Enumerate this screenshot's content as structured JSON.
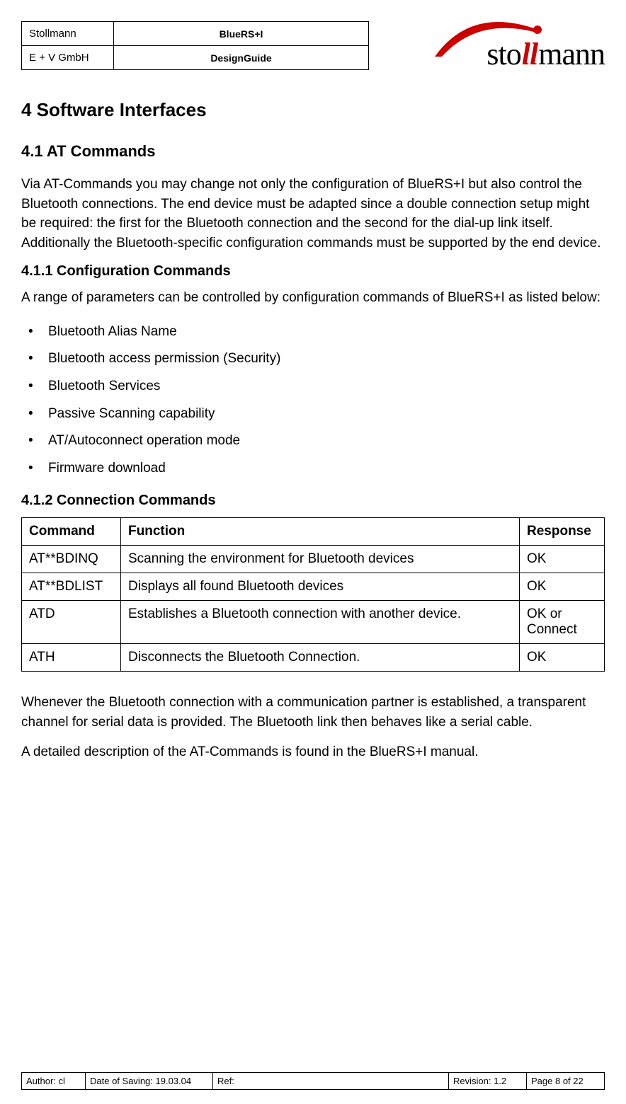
{
  "header": {
    "company_top": "Stollmann",
    "company_bottom": "E + V GmbH",
    "doc_top": "BlueRS+I",
    "doc_bottom": "DesignGuide",
    "logo_text_pre": "sto",
    "logo_text_mid": "ll",
    "logo_text_post": "mann"
  },
  "h1": "4   Software Interfaces",
  "h2": "4.1   AT Commands",
  "p1": "Via AT-Commands you may change not only the configuration of BlueRS+I but also control the Bluetooth connections. The end device must be adapted since a double connection setup might be required: the first for the Bluetooth connection and the second for the dial-up link itself. Additionally the Bluetooth-specific configuration commands must be supported by the end device.",
  "h3a": "4.1.1   Configuration Commands",
  "p2": "A range of parameters can be controlled by configuration commands of BlueRS+I as listed below:",
  "bullets": [
    "Bluetooth Alias Name",
    "Bluetooth access permission (Security)",
    "Bluetooth Services",
    "Passive Scanning capability",
    "AT/Autoconnect operation mode",
    "Firmware download"
  ],
  "h3b": "4.1.2   Connection Commands",
  "table": {
    "headers": [
      "Command",
      "Function",
      "Response"
    ],
    "rows": [
      {
        "cmd": "AT**BDINQ",
        "func": "Scanning the environment for Bluetooth devices",
        "resp": "OK"
      },
      {
        "cmd": "AT**BDLIST",
        "func": "Displays all found Bluetooth devices",
        "resp": "OK"
      },
      {
        "cmd": "ATD",
        "func": "Establishes a Bluetooth connection with another  device.",
        "resp": "OK or Connect"
      },
      {
        "cmd": "ATH",
        "func": "Disconnects the Bluetooth Connection.",
        "resp": "OK"
      }
    ]
  },
  "p3": "Whenever the Bluetooth connection with a communication partner is established, a transparent channel for serial data is provided. The Bluetooth link then behaves like a serial cable.",
  "p4": "A detailed description of the AT-Commands is found in the BlueRS+I manual.",
  "footer": {
    "author": "Author: cl",
    "date": "Date of Saving: 19.03.04",
    "ref": "Ref:",
    "revision": "Revision: 1.2",
    "page": "Page 8 of 22"
  }
}
